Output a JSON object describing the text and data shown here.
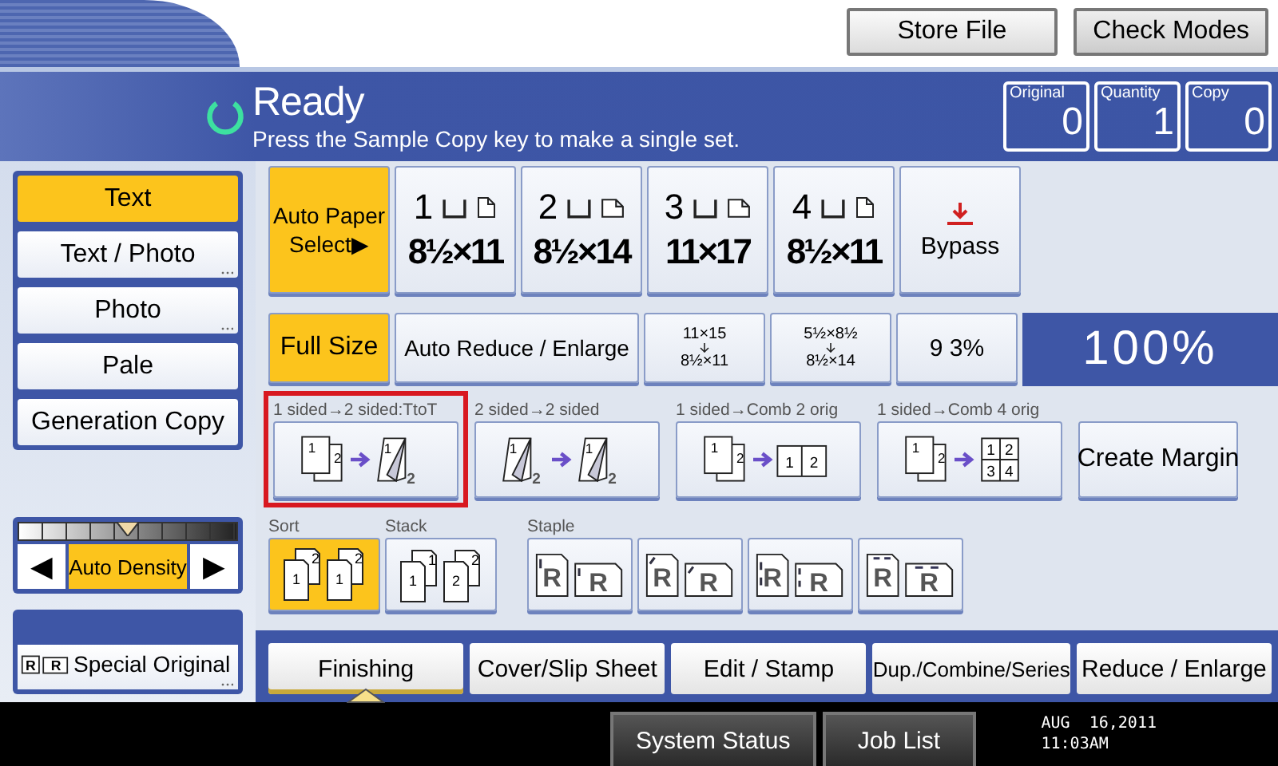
{
  "top_buttons": [
    {
      "label": "Store File"
    },
    {
      "label": "Check Modes"
    }
  ],
  "status": {
    "title": "Ready",
    "message": "Press the Sample Copy key to make a single set.",
    "counters": [
      {
        "label": "Original",
        "value": "0"
      },
      {
        "label": "Quantity",
        "value": "1"
      },
      {
        "label": "Copy",
        "value": "0"
      }
    ]
  },
  "image_modes": [
    {
      "label": "Text",
      "selected": true,
      "more": false
    },
    {
      "label": "Text / Photo",
      "selected": false,
      "more": true
    },
    {
      "label": "Photo",
      "selected": false,
      "more": true
    },
    {
      "label": "Pale",
      "selected": false,
      "more": false
    },
    {
      "label": "Generation Copy",
      "selected": false,
      "more": false
    }
  ],
  "density": {
    "left": "◀",
    "label": "Auto Density",
    "right": "▶",
    "level": 0.5,
    "selected": true
  },
  "special_original": {
    "label": "Special Original",
    "glyphs": [
      "R",
      "R"
    ]
  },
  "paper": [
    {
      "kind": "auto",
      "label": "Auto Paper Select▶",
      "selected": true
    },
    {
      "kind": "tray",
      "number": "1",
      "size": "8½×11",
      "landscape": false,
      "selected": false
    },
    {
      "kind": "tray",
      "number": "2",
      "size": "8½×14",
      "landscape": true,
      "selected": false
    },
    {
      "kind": "tray",
      "number": "3",
      "size": "11×17",
      "landscape": true,
      "selected": false
    },
    {
      "kind": "tray",
      "number": "4",
      "size": "8½×11",
      "landscape": false,
      "selected": false
    },
    {
      "kind": "bypass",
      "label": "Bypass",
      "selected": false
    }
  ],
  "ratio": [
    {
      "kind": "text",
      "label": "Full Size",
      "selected": true
    },
    {
      "kind": "text",
      "label": "Auto Reduce / Enlarge",
      "selected": false
    },
    {
      "kind": "preset",
      "from": "11×15",
      "to": "8½×11",
      "selected": false
    },
    {
      "kind": "preset",
      "from": "5½×8½",
      "to": "8½×14",
      "selected": false
    },
    {
      "kind": "text",
      "label": "9 3%",
      "selected": false
    }
  ],
  "ratio_display": "100%",
  "duplex": [
    {
      "kind": "one_to_two",
      "caption": "1 sided→2 sided:TtoT",
      "highlighted": true,
      "src": [
        "1",
        "2"
      ],
      "dst": [
        "1",
        "2"
      ]
    },
    {
      "kind": "two_to_two",
      "caption": "2 sided→2 sided",
      "highlighted": false,
      "src": [
        "1",
        "2"
      ],
      "dst": [
        "1",
        "2"
      ]
    },
    {
      "kind": "comb2",
      "caption": "1 sided→Comb 2 orig",
      "highlighted": false,
      "src": [
        "1",
        "2"
      ],
      "dst": [
        "1",
        "2"
      ]
    },
    {
      "kind": "comb4",
      "caption": "1 sided→Comb 4 orig",
      "highlighted": false,
      "src": [
        "1",
        "2"
      ],
      "dst": [
        "1",
        "2",
        "3",
        "4"
      ]
    }
  ],
  "create_margin": "Create Margin",
  "finishing": [
    {
      "kind": "sort",
      "caption": "Sort",
      "selected": true,
      "pages": [
        [
          "1",
          "2"
        ],
        [
          "1",
          "2"
        ]
      ]
    },
    {
      "kind": "stack",
      "caption": "Stack",
      "selected": false,
      "pages": [
        [
          "1",
          "1"
        ],
        [
          "2",
          "2"
        ]
      ]
    }
  ],
  "staple": {
    "caption": "Staple",
    "buttons": [
      {
        "kind": "left",
        "selected": false,
        "glyphs": [
          "R",
          "R"
        ]
      },
      {
        "kind": "corner",
        "selected": false,
        "glyphs": [
          "R",
          "R"
        ]
      },
      {
        "kind": "double",
        "selected": false,
        "glyphs": [
          "R",
          "R"
        ]
      },
      {
        "kind": "top",
        "selected": false,
        "glyphs": [
          "R",
          "R"
        ]
      }
    ]
  },
  "tabs": [
    {
      "label": "Finishing",
      "selected": true
    },
    {
      "label": "Cover/Slip Sheet",
      "selected": false
    },
    {
      "label": "Edit / Stamp",
      "selected": false
    },
    {
      "label": "Dup./Combine/Series",
      "selected": false
    },
    {
      "label": "Reduce / Enlarge",
      "selected": false
    }
  ],
  "bottom_buttons": [
    {
      "label": "System Status"
    },
    {
      "label": "Job List"
    }
  ],
  "date": "AUG  16,2011",
  "time": "11:03AM"
}
